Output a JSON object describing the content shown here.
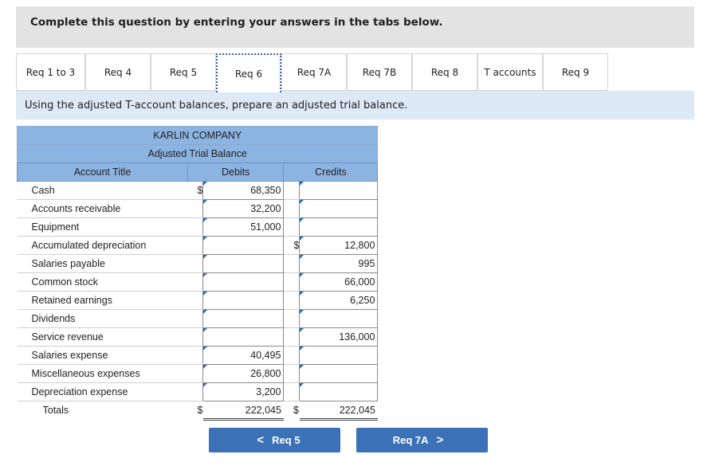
{
  "instructions": "Complete this question by entering your answers in the tabs below.",
  "tabs": [
    {
      "label": "Req 1 to 3"
    },
    {
      "label": "Req 4"
    },
    {
      "label": "Req 5"
    },
    {
      "label": "Req 6"
    },
    {
      "label": "Req 7A"
    },
    {
      "label": "Req 7B"
    },
    {
      "label": "Req 8"
    },
    {
      "label": "T accounts"
    },
    {
      "label": "Req 9"
    }
  ],
  "active_tab": "Req 6",
  "prompt": "Using the adjusted T-account balances, prepare an adjusted trial balance.",
  "table": {
    "company": "KARLIN COMPANY",
    "title": "Adjusted Trial Balance",
    "col_account": "Account Title",
    "col_debits": "Debits",
    "col_credits": "Credits",
    "rows": [
      {
        "account": "Cash",
        "debit_cur": "$",
        "debit": "68,350",
        "credit_cur": "",
        "credit": ""
      },
      {
        "account": "Accounts receivable",
        "debit_cur": "",
        "debit": "32,200",
        "credit_cur": "",
        "credit": ""
      },
      {
        "account": "Equipment",
        "debit_cur": "",
        "debit": "51,000",
        "credit_cur": "",
        "credit": ""
      },
      {
        "account": "Accumulated depreciation",
        "debit_cur": "",
        "debit": "",
        "credit_cur": "$",
        "credit": "12,800"
      },
      {
        "account": "Salaries payable",
        "debit_cur": "",
        "debit": "",
        "credit_cur": "",
        "credit": "995"
      },
      {
        "account": "Common stock",
        "debit_cur": "",
        "debit": "",
        "credit_cur": "",
        "credit": "66,000"
      },
      {
        "account": "Retained earnings",
        "debit_cur": "",
        "debit": "",
        "credit_cur": "",
        "credit": "6,250"
      },
      {
        "account": "Dividends",
        "debit_cur": "",
        "debit": "",
        "credit_cur": "",
        "credit": ""
      },
      {
        "account": "Service revenue",
        "debit_cur": "",
        "debit": "",
        "credit_cur": "",
        "credit": "136,000"
      },
      {
        "account": "Salaries expense",
        "debit_cur": "",
        "debit": "40,495",
        "credit_cur": "",
        "credit": ""
      },
      {
        "account": "Miscellaneous expenses",
        "debit_cur": "",
        "debit": "26,800",
        "credit_cur": "",
        "credit": ""
      },
      {
        "account": "Depreciation expense",
        "debit_cur": "",
        "debit": "3,200",
        "credit_cur": "",
        "credit": ""
      }
    ],
    "totals": {
      "label": "Totals",
      "debit_cur": "$",
      "debit": "222,045",
      "credit_cur": "$",
      "credit": "222,045"
    }
  },
  "nav": {
    "prev_label": "Req 5",
    "next_label": "Req 7A",
    "prev_icon": "chevron-left-icon",
    "next_icon": "chevron-right-icon"
  },
  "colors": {
    "header_blue": "#8cb4e2",
    "button_blue": "#3b72b7",
    "instruction_bg": "#dde9f5",
    "banner_bg": "#e3e3e3"
  }
}
